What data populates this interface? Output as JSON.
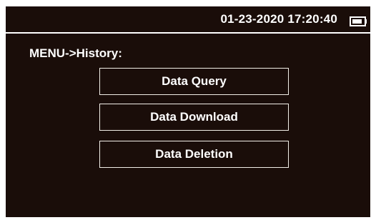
{
  "status_bar": {
    "datetime": "01-23-2020 17:20:40",
    "battery_icon": "battery-icon",
    "battery_level": 0.85
  },
  "breadcrumb": "MENU->History:",
  "menu": {
    "items": [
      {
        "label": "Data Query"
      },
      {
        "label": "Data Download"
      },
      {
        "label": "Data Deletion"
      }
    ]
  },
  "colors": {
    "screen_background": "#1a0d09",
    "text": "#ffffff",
    "bezel": "#ffffff"
  }
}
